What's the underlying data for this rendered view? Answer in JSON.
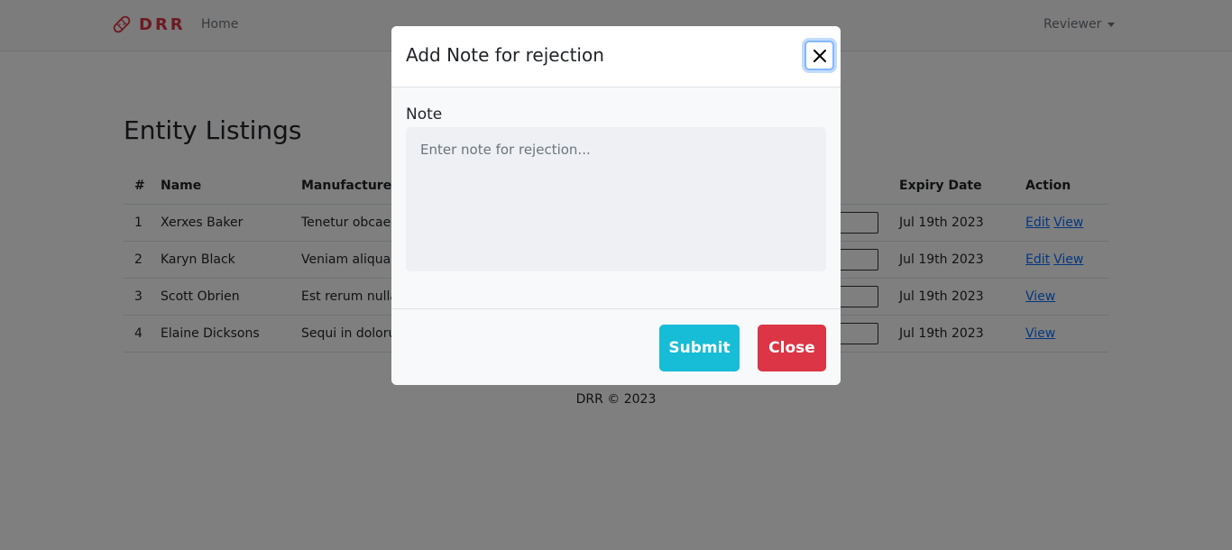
{
  "navbar": {
    "brand": "DRR",
    "home_label": "Home",
    "user_menu_label": "Reviewer"
  },
  "page": {
    "title": "Entity Listings"
  },
  "table": {
    "headers": {
      "num": "#",
      "name": "Name",
      "manufacturer": "Manufacturer",
      "expiry": "Expiry Date",
      "action": "Action"
    },
    "rows": [
      {
        "num": "1",
        "name": "Xerxes Baker",
        "manufacturer": "Tenetur obcaeca",
        "expiry": "Jul 19th 2023",
        "actions": [
          "Edit",
          "View"
        ]
      },
      {
        "num": "2",
        "name": "Karyn Black",
        "manufacturer": "Veniam aliqua E",
        "expiry": "Jul 19th 2023",
        "actions": [
          "Edit",
          "View"
        ]
      },
      {
        "num": "3",
        "name": "Scott Obrien",
        "manufacturer": "Est rerum nulla",
        "expiry": "Jul 19th 2023",
        "actions": [
          "View"
        ]
      },
      {
        "num": "4",
        "name": "Elaine Dicksons",
        "manufacturer": "Sequi in doloru",
        "expiry": "Jul 19th 2023",
        "actions": [
          "View"
        ]
      }
    ]
  },
  "footer": {
    "text": "DRR © 2023"
  },
  "modal": {
    "title": "Add Note for rejection",
    "note_label": "Note",
    "note_placeholder": "Enter note for rejection...",
    "note_value": "",
    "submit_label": "Submit",
    "close_label": "Close"
  },
  "colors": {
    "brand": "#dc3545",
    "submit": "#17bcd6",
    "close": "#dc3545",
    "link": "#0d6efd"
  }
}
